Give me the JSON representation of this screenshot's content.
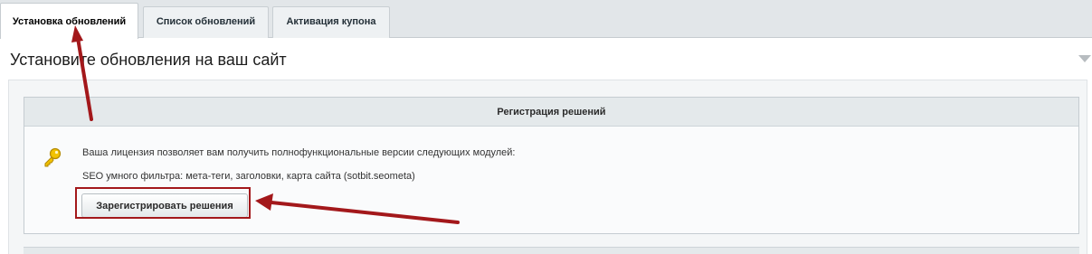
{
  "tabs": [
    {
      "label": "Установка обновлений",
      "active": true
    },
    {
      "label": "Список обновлений",
      "active": false
    },
    {
      "label": "Активация купона",
      "active": false
    }
  ],
  "page_title": "Установите обновления на ваш сайт",
  "registration": {
    "header": "Регистрация решений",
    "license_text": "Ваша лицензия позволяет вам получить полнофункциональные версии следующих модулей:",
    "module_text": "SEO умного фильтра: мета-теги, заголовки, карта сайта (sotbit.seometa)",
    "button_label": "Зарегистрировать решения"
  },
  "icons": {
    "key": "key-icon",
    "collapse": "triangle-down-icon"
  },
  "colors": {
    "annotation_red": "#a3181b",
    "key_gold": "#e6b800"
  }
}
